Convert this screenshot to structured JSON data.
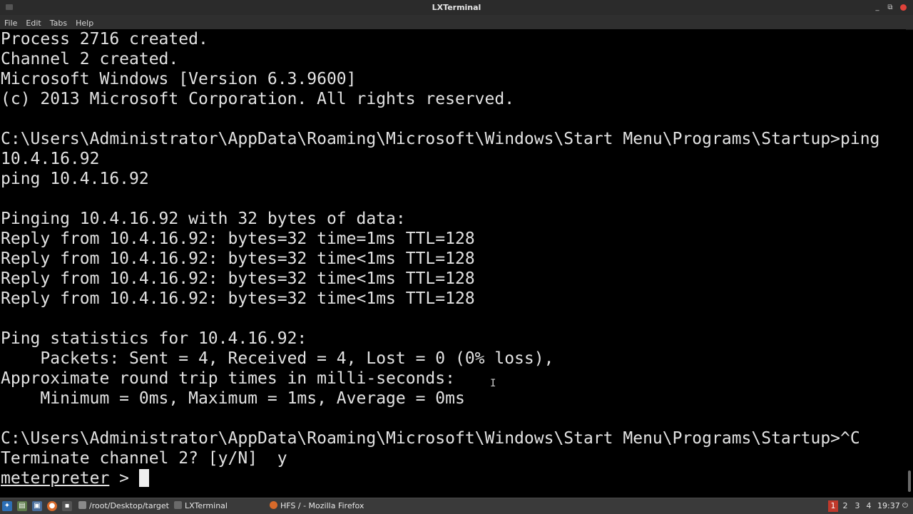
{
  "window": {
    "title": "LXTerminal",
    "controls": {
      "minimize": "_",
      "maximize": "⧉",
      "close": "×"
    }
  },
  "menubar": {
    "items": [
      "File",
      "Edit",
      "Tabs",
      "Help"
    ]
  },
  "terminal": {
    "lines": [
      "Process 2716 created.",
      "Channel 2 created.",
      "Microsoft Windows [Version 6.3.9600]",
      "(c) 2013 Microsoft Corporation. All rights reserved.",
      "",
      "C:\\Users\\Administrator\\AppData\\Roaming\\Microsoft\\Windows\\Start Menu\\Programs\\Startup>ping",
      "10.4.16.92",
      "ping 10.4.16.92",
      "",
      "Pinging 10.4.16.92 with 32 bytes of data:",
      "Reply from 10.4.16.92: bytes=32 time=1ms TTL=128",
      "Reply from 10.4.16.92: bytes=32 time<1ms TTL=128",
      "Reply from 10.4.16.92: bytes=32 time<1ms TTL=128",
      "Reply from 10.4.16.92: bytes=32 time<1ms TTL=128",
      "",
      "Ping statistics for 10.4.16.92:",
      "    Packets: Sent = 4, Received = 4, Lost = 0 (0% loss),",
      "Approximate round trip times in milli-seconds:",
      "    Minimum = 0ms, Maximum = 1ms, Average = 0ms",
      "",
      "C:\\Users\\Administrator\\AppData\\Roaming\\Microsoft\\Windows\\Start Menu\\Programs\\Startup>^C",
      "Terminate channel 2? [y/N]  y"
    ],
    "prompt_word": "meterpreter",
    "prompt_suffix": " > "
  },
  "taskbar": {
    "launchers": [
      "menu-icon",
      "file-manager-icon",
      "terminal-icon",
      "firefox-icon",
      "console-icon"
    ],
    "tasks": [
      {
        "label": "/root/Desktop/target",
        "icon": "terminal-icon"
      },
      {
        "label": "LXTerminal",
        "icon": "terminal-icon"
      },
      {
        "label": "HFS / - Mozilla Firefox",
        "icon": "firefox-icon"
      }
    ],
    "desktops": [
      "1",
      "2",
      "3",
      "4"
    ],
    "active_desktop": "1",
    "clock": "19:37"
  },
  "colors": {
    "terminal_bg": "#000000",
    "terminal_fg": "#e2e2e2",
    "titlebar_bg": "#2b2b2b",
    "active_desktop": "#c0392b"
  }
}
